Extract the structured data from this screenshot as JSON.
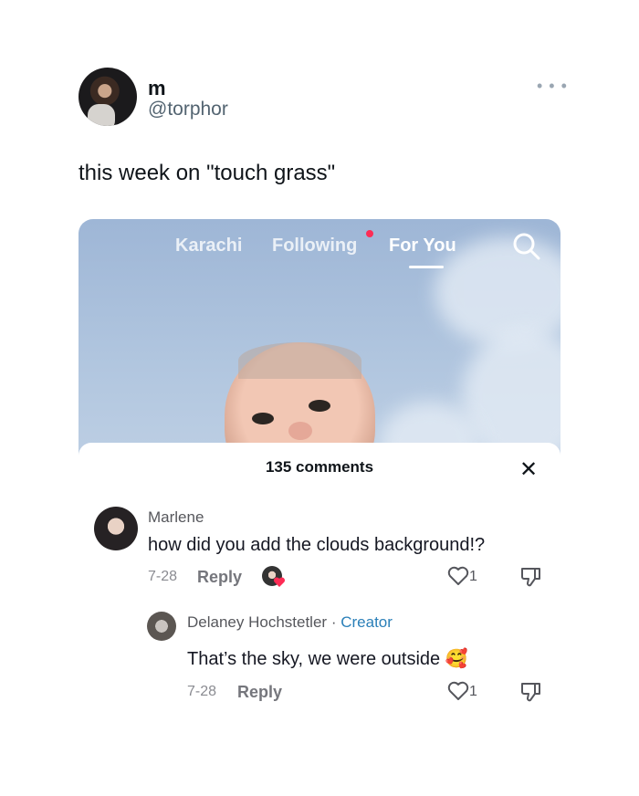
{
  "tweet": {
    "display_name": "m",
    "handle": "@torphor",
    "more_icon": "more-horizontal-icon",
    "text": "this week on \"touch grass\""
  },
  "video": {
    "tabs": [
      "Karachi",
      "Following",
      "For You"
    ],
    "active_tab": "For You",
    "search_icon": "search-icon",
    "accent": "#fe2c55"
  },
  "comments_sheet": {
    "count_label": "135 comments",
    "close_icon": "close-icon",
    "comments": [
      {
        "author": "Marlene",
        "text": "how did you add the clouds background!?",
        "date": "7-28",
        "reply_label": "Reply",
        "likes": "1"
      },
      {
        "author": "Delaney Hochstetler",
        "badge": "Creator",
        "separator": "·",
        "text": "That’s the sky, we were outside",
        "emoji": "🥰",
        "date": "7-28",
        "reply_label": "Reply",
        "likes": "1"
      }
    ]
  }
}
